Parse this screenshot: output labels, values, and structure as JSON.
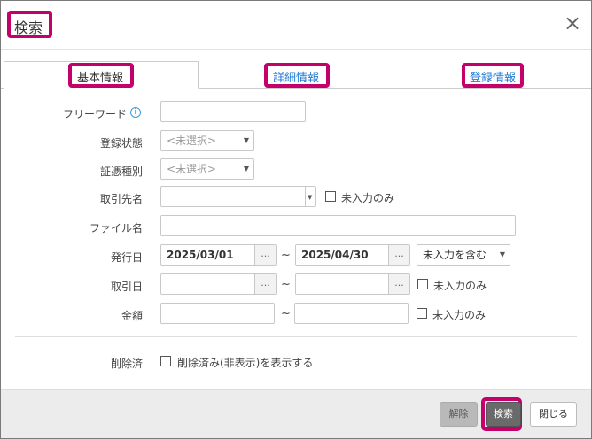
{
  "dialog": {
    "title": "検索",
    "close_glyph": "×"
  },
  "tabs": [
    {
      "label": "基本情報",
      "active": true
    },
    {
      "label": "詳細情報",
      "active": false
    },
    {
      "label": "登録情報",
      "active": false
    }
  ],
  "form": {
    "freeword": {
      "label": "フリーワード",
      "value": "",
      "info_glyph": "i"
    },
    "status": {
      "label": "登録状態",
      "value": "<未選択>"
    },
    "voucher_type": {
      "label": "証憑種別",
      "value": "<未選択>"
    },
    "partner": {
      "label": "取引先名",
      "value": "",
      "empty_only_label": "未入力のみ",
      "empty_only_checked": false
    },
    "filename": {
      "label": "ファイル名",
      "value": ""
    },
    "issue_date": {
      "label": "発行日",
      "from": "2025/03/01",
      "to": "2025/04/30",
      "tilde": "~",
      "option": "未入力を含む",
      "picker_glyph": "..."
    },
    "transaction_date": {
      "label": "取引日",
      "from": "",
      "to": "",
      "tilde": "~",
      "empty_only_label": "未入力のみ",
      "empty_only_checked": false,
      "picker_glyph": "..."
    },
    "amount": {
      "label": "金額",
      "from": "",
      "to": "",
      "tilde": "~",
      "empty_only_label": "未入力のみ",
      "empty_only_checked": false
    },
    "deleted": {
      "label": "削除済",
      "checkbox_label": "削除済み(非表示)を表示する",
      "checked": false
    }
  },
  "footer": {
    "clear_label": "解除",
    "search_label": "検索",
    "close_label": "閉じる"
  },
  "colors": {
    "highlight": "#c4006a",
    "tab_link": "#1d7bd6",
    "info": "#3a9bd9"
  }
}
